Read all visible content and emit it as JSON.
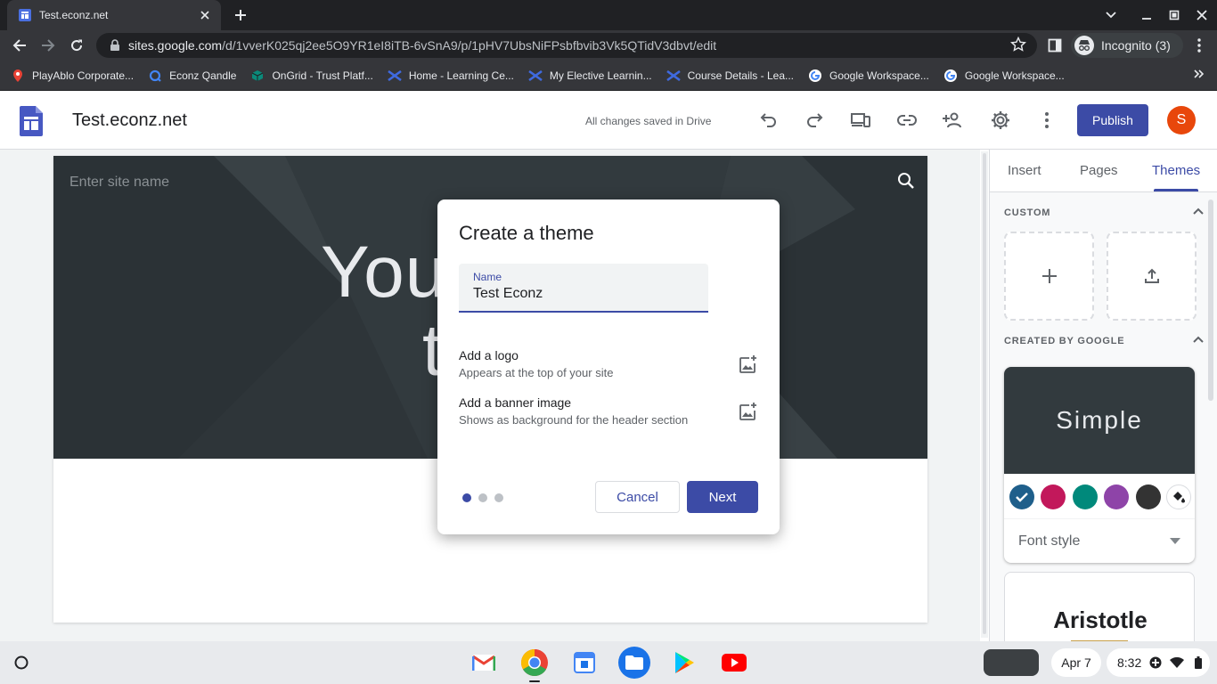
{
  "browser": {
    "tab_title": "Test.econz.net",
    "url_domain": "sites.google.com",
    "url_path": "/d/1vverK025qj2ee5O9YR1eI8iTB-6vSnA9/p/1pHV7UbsNiFPsbfbvib3Vk5QTidV3dbvt/edit",
    "incognito_label": "Incognito (3)"
  },
  "bookmarks": [
    {
      "label": "PlayAblo Corporate..."
    },
    {
      "label": "Econz Qandle"
    },
    {
      "label": "OnGrid - Trust Platf..."
    },
    {
      "label": "Home - Learning Ce..."
    },
    {
      "label": "My Elective Learnin..."
    },
    {
      "label": "Course Details - Lea..."
    },
    {
      "label": "Google Workspace..."
    },
    {
      "label": "Google Workspace..."
    }
  ],
  "header": {
    "site_title": "Test.econz.net",
    "save_status": "All changes saved in Drive",
    "publish_label": "Publish",
    "avatar_initial": "S"
  },
  "canvas": {
    "site_name_placeholder": "Enter site name",
    "big_title_line1": "You",
    "big_title_line2": "t"
  },
  "dialog": {
    "title": "Create a theme",
    "name_label": "Name",
    "name_value": "Test Econz",
    "logo_title": "Add a logo",
    "logo_subtitle": "Appears at the top of your site",
    "banner_title": "Add a banner image",
    "banner_subtitle": "Shows as background for the header section",
    "cancel_label": "Cancel",
    "next_label": "Next",
    "step_current": 1,
    "step_total": 3
  },
  "panel": {
    "tabs": [
      {
        "label": "Insert"
      },
      {
        "label": "Pages"
      },
      {
        "label": "Themes"
      }
    ],
    "active_tab": "Themes",
    "custom_header": "CUSTOM",
    "google_header": "CREATED BY GOOGLE",
    "simple_theme_name": "Simple",
    "swatches": [
      "#1f5f8b",
      "#c2185b",
      "#00897b",
      "#8e44a8",
      "#333333"
    ],
    "selected_swatch": 0,
    "font_style_label": "Font style",
    "aristotle_theme_name": "Aristotle"
  },
  "shelf": {
    "date": "Apr 7",
    "time": "8:32"
  },
  "colors": {
    "accent": "#3c4ba6",
    "banner": "#323a3e"
  }
}
